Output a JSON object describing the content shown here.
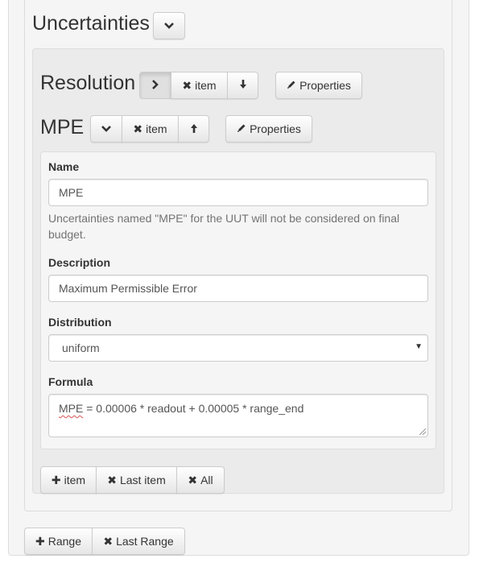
{
  "uncertainties": {
    "title": "Uncertainties",
    "toggle_icon": "chevron-down-icon"
  },
  "resolution": {
    "title": "Resolution",
    "expand_icon": "chevron-right-icon",
    "remove_item_label": "item",
    "move_down_icon": "arrow-down-icon",
    "properties_label": "Properties"
  },
  "mpe": {
    "title": "MPE",
    "collapse_icon": "chevron-down-icon",
    "remove_item_label": "item",
    "move_up_icon": "arrow-up-icon",
    "properties_label": "Properties"
  },
  "form": {
    "name_label": "Name",
    "name_value": "MPE",
    "name_help": "Uncertainties named \"MPE\" for the UUT will not be considered on final budget.",
    "description_label": "Description",
    "description_value": "Maximum Permissible Error",
    "distribution_label": "Distribution",
    "distribution_value": "uniform",
    "formula_label": "Formula",
    "formula_var": "MPE",
    "formula_rest": " = 0.00006 * readout + 0.00005 * range_end"
  },
  "item_actions": {
    "add_item_label": "item",
    "remove_last_item_label": "Last item",
    "remove_all_label": "All"
  },
  "range_actions": {
    "add_range_label": "Range",
    "remove_last_range_label": "Last Range"
  }
}
